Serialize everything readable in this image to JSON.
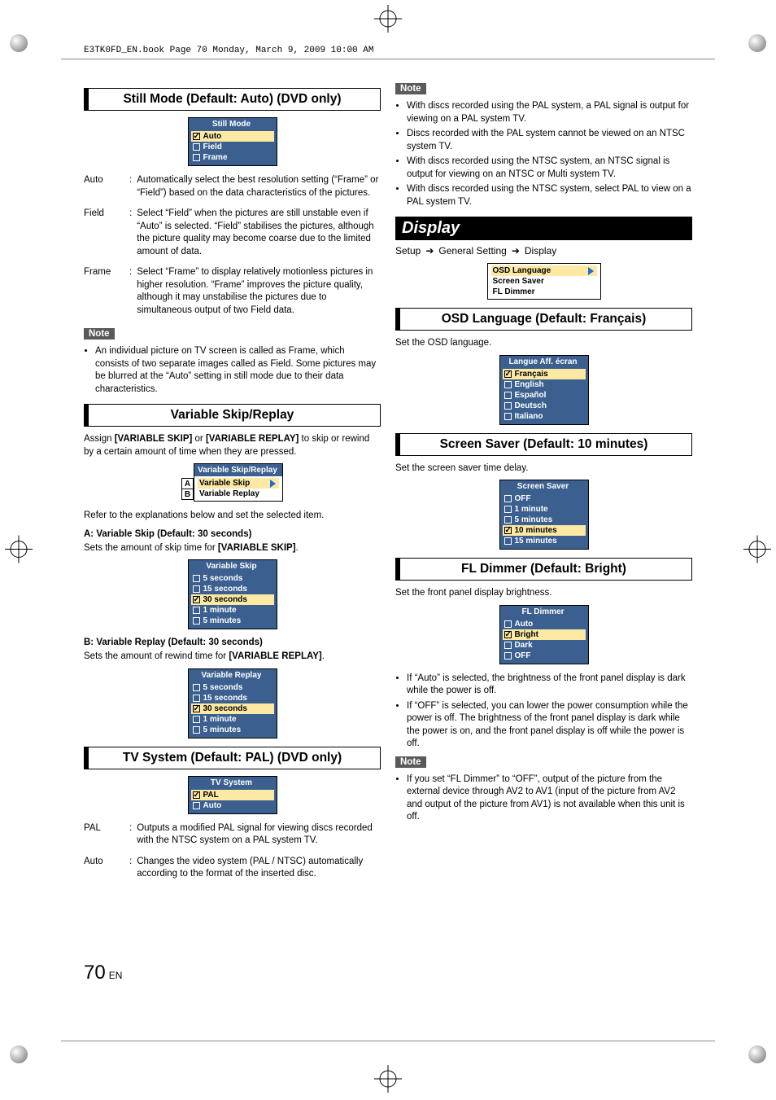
{
  "header_line": "E3TK0FD_EN.book  Page 70  Monday, March 9, 2009  10:00 AM",
  "page_number": "70",
  "page_lang": "EN",
  "left": {
    "still_mode": {
      "title": "Still Mode (Default: Auto) (DVD only)",
      "menu_title": "Still Mode",
      "options": [
        "Auto",
        "Field",
        "Frame"
      ],
      "selected": 0,
      "defs": [
        {
          "term": "Auto",
          "body": "Automatically select the best resolution setting (“Frame” or “Field”) based on the data characteristics of the pictures."
        },
        {
          "term": "Field",
          "body": "Select “Field” when the pictures are still unstable even if “Auto” is selected. “Field” stabilises the pictures, although the picture quality may become coarse due to the limited amount of data."
        },
        {
          "term": "Frame",
          "body": "Select “Frame” to display relatively motionless pictures in higher resolution. “Frame” improves the picture quality, although it may unstabilise the pictures due to simultaneous output of two Field data."
        }
      ],
      "note_label": "Note",
      "note_items": [
        "An individual picture on TV screen is called as Frame, which consists of two separate images called as Field. Some pictures may be blurred at the “Auto” setting in still mode due to their data characteristics."
      ]
    },
    "variable_skip": {
      "title": "Variable Skip/Replay",
      "intro_pre": "Assign ",
      "intro_b1": "[VARIABLE SKIP]",
      "intro_mid": " or ",
      "intro_b2": "[VARIABLE REPLAY]",
      "intro_post": " to skip or rewind by a certain amount of time when they are pressed.",
      "menu_title": "Variable Skip/Replay",
      "row_a": "Variable Skip",
      "row_b": "Variable Replay",
      "tag_a": "A",
      "tag_b": "B",
      "refer": "Refer to the explanations below and set the selected item.",
      "a_heading": "A: Variable Skip (Default: 30 seconds)",
      "a_intro_pre": "Sets the amount of skip time for ",
      "a_intro_b": "[VARIABLE SKIP]",
      "a_intro_post": ".",
      "a_menu_title": "Variable Skip",
      "a_options": [
        "5 seconds",
        "15 seconds",
        "30 seconds",
        "1 minute",
        "5 minutes"
      ],
      "a_selected": 2,
      "b_heading": "B: Variable Replay (Default: 30 seconds)",
      "b_intro_pre": "Sets the amount of rewind time for ",
      "b_intro_b": "[VARIABLE REPLAY]",
      "b_intro_post": ".",
      "b_menu_title": "Variable Replay",
      "b_options": [
        "5 seconds",
        "15 seconds",
        "30 seconds",
        "1 minute",
        "5 minutes"
      ],
      "b_selected": 2
    },
    "tv_system": {
      "title": "TV System (Default: PAL) (DVD only)",
      "menu_title": "TV System",
      "options": [
        "PAL",
        "Auto"
      ],
      "selected": 0,
      "defs": [
        {
          "term": "PAL",
          "body": "Outputs a modified PAL signal for viewing discs recorded with the NTSC system on a PAL system TV."
        },
        {
          "term": "Auto",
          "body": "Changes the video system (PAL / NTSC) automatically according to the format of the inserted disc."
        }
      ]
    }
  },
  "right": {
    "top_note_label": "Note",
    "top_note_items": [
      "With discs recorded using the PAL system, a PAL signal is output for viewing on a PAL system TV.",
      "Discs recorded with the PAL system cannot be viewed on an NTSC system TV.",
      "With discs recorded using the NTSC system, an NTSC signal is output for viewing on an NTSC or Multi system TV.",
      "With discs recorded using the NTSC system, select PAL to view on a PAL system TV."
    ],
    "display_header": "Display",
    "crumb": [
      "Setup",
      "General Setting",
      "Display"
    ],
    "disp_menu": {
      "items": [
        "OSD Language",
        "Screen Saver",
        "FL Dimmer"
      ],
      "sel": 0
    },
    "osd": {
      "title": "OSD Language (Default: Français)",
      "intro": "Set the OSD language.",
      "menu_title": "Langue Aff. écran",
      "options": [
        "Français",
        "English",
        "Español",
        "Deutsch",
        "Italiano"
      ],
      "selected": 0
    },
    "ss": {
      "title": "Screen Saver (Default: 10 minutes)",
      "intro": "Set the screen saver time delay.",
      "menu_title": "Screen Saver",
      "options": [
        "OFF",
        "1 minute",
        "5 minutes",
        "10 minutes",
        "15 minutes"
      ],
      "selected": 3
    },
    "fl": {
      "title": "FL Dimmer (Default: Bright)",
      "intro": "Set the front panel display brightness.",
      "menu_title": "FL Dimmer",
      "options": [
        "Auto",
        "Bright",
        "Dark",
        "OFF"
      ],
      "selected": 1,
      "bullets": [
        "If “Auto” is selected, the brightness of the front panel display is dark while the power is off.",
        "If “OFF” is selected, you can lower the power consumption while the power is off. The brightness of the front panel display is dark while the power is on, and the front panel display is off while the power is off."
      ],
      "note_label": "Note",
      "note_items": [
        "If you set “FL Dimmer” to “OFF”, output of the picture from the external device through AV2 to AV1 (input of the picture from AV2 and output of the picture from AV1) is not available when this unit is off."
      ]
    }
  }
}
